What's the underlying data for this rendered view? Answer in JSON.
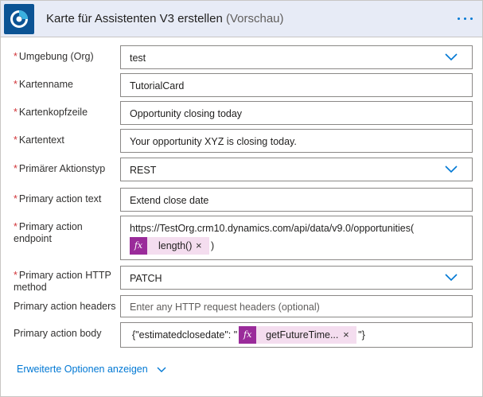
{
  "header": {
    "title": "Karte für Assistenten V3 erstellen",
    "title_suffix": "(Vorschau)",
    "more_label": "···"
  },
  "fields": [
    {
      "label": "Umgebung (Org)",
      "required": true,
      "type": "dropdown",
      "value": "test"
    },
    {
      "label": "Kartenname",
      "required": true,
      "type": "text",
      "value": "TutorialCard"
    },
    {
      "label": "Kartenkopfzeile",
      "required": true,
      "type": "text",
      "value": "Opportunity closing today"
    },
    {
      "label": "Kartentext",
      "required": true,
      "type": "text",
      "value": "Your opportunity XYZ is closing today."
    },
    {
      "label": "Primärer Aktionstyp",
      "required": true,
      "type": "dropdown",
      "value": "REST"
    },
    {
      "label": "Primary action text",
      "required": true,
      "type": "text",
      "value": "Extend close date"
    },
    {
      "label_line1": "Primary action",
      "label_line2": "endpoint",
      "required": true,
      "type": "text",
      "value": "https://TestOrg.crm10.dynamics.com/api/data/v9.0/opportunities(",
      "token": {
        "fx": "fx",
        "text": "length()",
        "remove": "×"
      },
      "suffix": ")"
    },
    {
      "label_line1": "Primary action HTTP",
      "label_line2": "method",
      "required": true,
      "type": "dropdown",
      "value": "PATCH"
    },
    {
      "label": "Primary action headers",
      "required": false,
      "type": "text",
      "placeholder": "Enter any HTTP request headers (optional)"
    },
    {
      "label": "Primary action body",
      "required": false,
      "type": "text",
      "prefix": "{\"estimatedclosedate\": \"",
      "token": {
        "fx": "fx",
        "text": "getFutureTime...",
        "remove": "×"
      },
      "suffix": "\"}"
    }
  ],
  "advanced_options": {
    "label": "Erweiterte Optionen anzeigen"
  },
  "required_marker": "*",
  "colors": {
    "accent": "#0078d4",
    "header_bg": "#e7ebf6",
    "token_bg": "#f4ddef",
    "fx_bg": "#9a2b9a",
    "required": "#d13438"
  }
}
